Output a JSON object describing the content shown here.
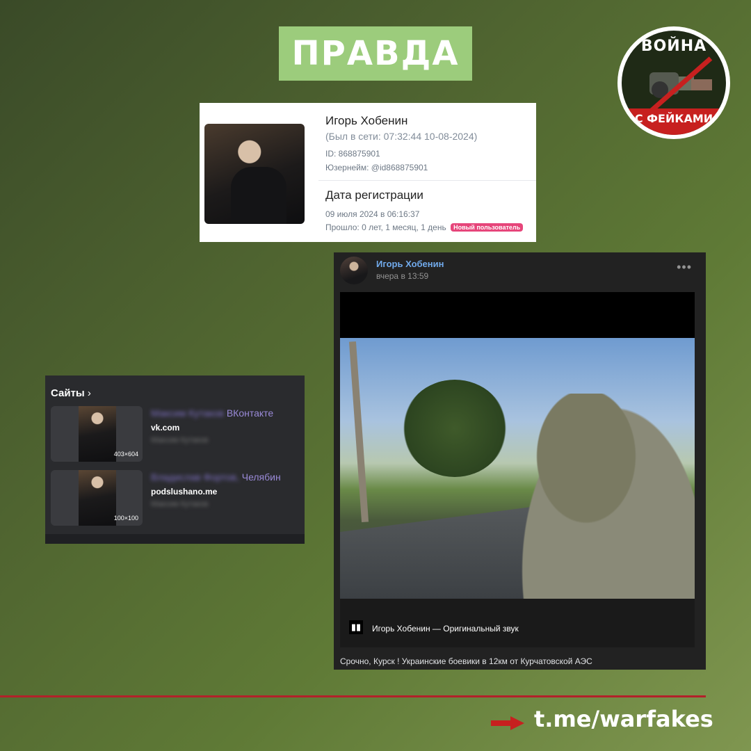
{
  "badge": {
    "label": "ПРАВДА",
    "color": "#9ccc7c"
  },
  "logo": {
    "top_text": "ВОЙНА",
    "bottom_text": "С ФЕЙКАМИ",
    "accent": "#c7201f"
  },
  "profile": {
    "name": "Игорь Хобенин",
    "last_seen": "(Был в сети: 07:32:44 10-08-2024)",
    "id": "ID: 868875901",
    "username": "Юзернейм: @id868875901",
    "reg_title": "Дата регистрации",
    "reg_date": "09 июля 2024 в 06:16:37",
    "elapsed": "Прошло: 0 лет, 1 месяц, 1 день",
    "new_user_badge": "Новый пользователь"
  },
  "sites": {
    "header": "Сайты",
    "chevron_icon": "chevron-right-icon",
    "items": [
      {
        "title_suffix": "ВКонтакте",
        "domain": "vk.com",
        "dims": "403×604"
      },
      {
        "title_suffix": "Челябин",
        "domain": "podslushano.me",
        "dims": "100×100"
      }
    ]
  },
  "post": {
    "author": "Игорь Хобенин",
    "time": "вчера в 13:59",
    "more": "•••",
    "audio": "Игорь Хобенин — Оригинальный звук",
    "caption": "Срочно, Курск ! Украинские боевики в 12км от Курчатовской АЭС"
  },
  "footer": {
    "url": "t.me/warfakes",
    "line_color": "#b3212a"
  }
}
